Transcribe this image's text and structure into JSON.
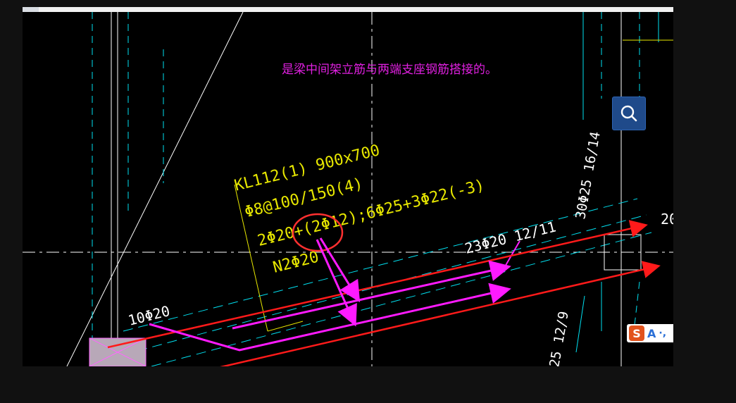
{
  "annotation": {
    "text": "是梁中间架立筋与两端支座钢筋搭接的。",
    "color": "#e020e0"
  },
  "beam_label": {
    "lines": [
      "KL112(1) 900x700",
      "Φ8@100/150(4)",
      "2Φ20+(2Φ12);6Φ25+3Φ22(-3)",
      "N2Φ20"
    ],
    "color": "#e8e800"
  },
  "rebar_labels": {
    "left": "10Φ20",
    "right": "23Φ20 12/11",
    "vertical_upper": "30Φ25 16/14",
    "vertical_lower": "25 12/9",
    "edge": "20"
  },
  "colors": {
    "arrow_red": "#ff1a1a",
    "arrow_magenta": "#ff1aff",
    "gridline": "#ffffff",
    "beam_edge": "#00e0f0",
    "highlight_circle": "#ff3030"
  },
  "toolbar": {
    "zoom_icon": "magnifier-icon",
    "ime_logo": "S",
    "ime_mode": "A",
    "ime_extra": "·,"
  }
}
